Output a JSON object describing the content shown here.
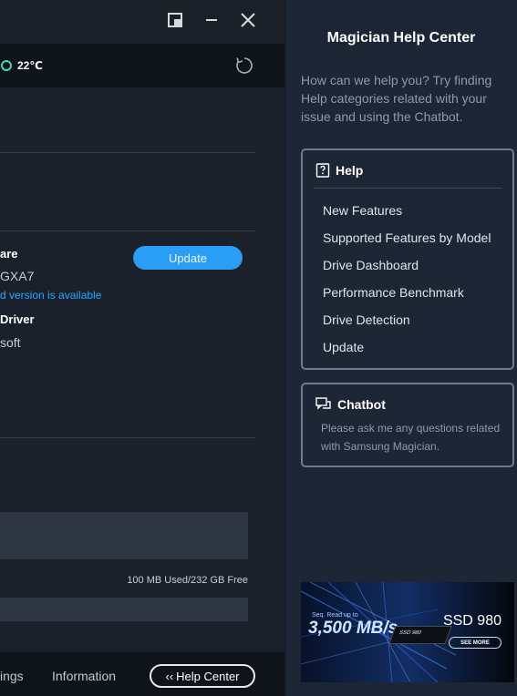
{
  "status": {
    "temperature": "22℃"
  },
  "firmware": {
    "title": "are",
    "model": "GXA7",
    "note": "d version is available",
    "update_label": "Update"
  },
  "driver": {
    "title": "Driver",
    "vendor": "soft"
  },
  "storage": {
    "usage": "100 MB Used/232 GB Free"
  },
  "footer": {
    "settings_label": "ings",
    "information_label": "Information",
    "help_center_label": "Help Center",
    "help_center_icon": "‹‹"
  },
  "help_center": {
    "title": "Magician Help Center",
    "intro": "How can we help you? Try finding Help categories related with your issue and using the Chatbot.",
    "help_card": {
      "title": "Help",
      "items": [
        {
          "label": "New Features"
        },
        {
          "label": "Supported Features by Model"
        },
        {
          "label": "Drive Dashboard"
        },
        {
          "label": "Performance Benchmark"
        },
        {
          "label": "Drive Detection"
        },
        {
          "label": "Update"
        }
      ]
    },
    "chatbot_card": {
      "title": "Chatbot",
      "description": "Please ask me any questions related with Samsung Magician."
    },
    "banner": {
      "speed_label": "Seq. Read up to",
      "speed": "3,500 MB/s",
      "ssd_text": "SSD 980",
      "model": "SSD 980",
      "cta": "SEE MORE"
    }
  },
  "colors": {
    "accent": "#2a9df4",
    "link": "#2aa8ff",
    "temperature_ring": "#4fd6b0"
  }
}
